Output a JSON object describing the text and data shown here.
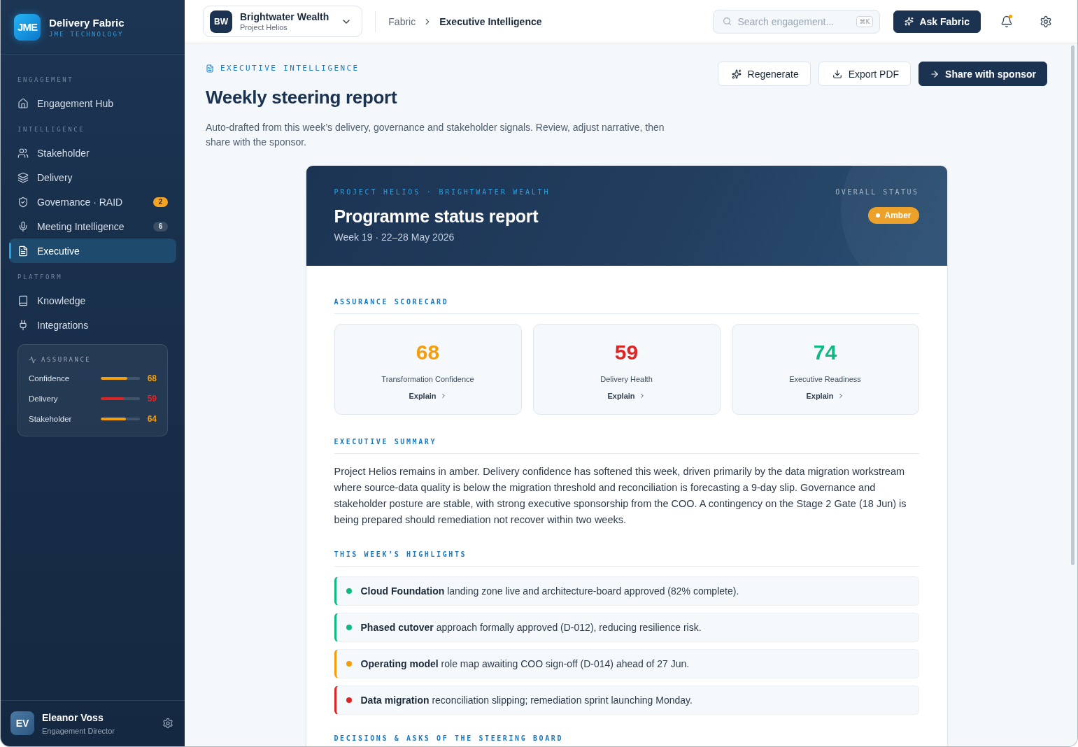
{
  "sidebar": {
    "brand": {
      "logo": "JME",
      "name": "Delivery Fabric",
      "tagline": "JME TECHNOLOGY"
    },
    "sections": [
      {
        "label": "ENGAGEMENT",
        "items": [
          {
            "label": "Engagement Hub",
            "selected": false
          }
        ]
      },
      {
        "label": "INTELLIGENCE",
        "items": [
          {
            "label": "Stakeholder",
            "selected": false
          },
          {
            "label": "Delivery",
            "selected": false
          },
          {
            "label": "Governance · RAID",
            "selected": false,
            "badge": {
              "text": "2",
              "kind": "alert"
            }
          },
          {
            "label": "Meeting Intelligence",
            "selected": false,
            "badge": {
              "text": "6",
              "kind": "count"
            }
          },
          {
            "label": "Executive",
            "selected": true
          }
        ]
      },
      {
        "label": "PLATFORM",
        "items": [
          {
            "label": "Knowledge",
            "selected": false
          },
          {
            "label": "Integrations",
            "selected": false
          }
        ]
      }
    ],
    "assurance": {
      "title": "ASSURANCE",
      "metrics": [
        {
          "label": "Confidence",
          "level": 0.68,
          "value": "68",
          "color": "#f59e0b"
        },
        {
          "label": "Delivery",
          "level": 0.59,
          "value": "59",
          "color": "#dc2626"
        },
        {
          "label": "Stakeholder",
          "level": 0.64,
          "value": "64",
          "color": "#f59e0b"
        }
      ]
    },
    "user": {
      "initials": "EV",
      "name": "Eleanor Voss",
      "role": "Engagement Director"
    }
  },
  "top_bar": {
    "engagement": {
      "initials": "BW",
      "name": "Brightwater Wealth",
      "project": "Project Helios"
    },
    "breadcrumb": [
      "Fabric",
      "Executive Intelligence"
    ],
    "search": {
      "placeholder": "Search engagement...",
      "shortcut": "⌘K"
    },
    "ask_button": "Ask Fabric",
    "notifications_unread": true
  },
  "page": {
    "eyebrow": "EXECUTIVE INTELLIGENCE",
    "title": "Weekly steering report",
    "description": "Auto-drafted from this week’s delivery, governance and stakeholder signals. Review, adjust narrative, then share with the sponsor.",
    "actions": [
      {
        "label": "Regenerate",
        "kind": "secondary"
      },
      {
        "label": "Export PDF",
        "kind": "secondary"
      },
      {
        "label": "Share with sponsor",
        "kind": "primary"
      }
    ]
  },
  "report": {
    "eyebrow": "PROJECT HELIOS · BRIGHTWATER WEALTH",
    "title": "Programme status report",
    "period": "Week 19 · 22–28 May 2026",
    "status_label": "OVERALL STATUS",
    "status": {
      "text": "Amber",
      "kind": "amber"
    },
    "scorecard_heading": "ASSURANCE SCORECARD",
    "scorecard": [
      {
        "value": "68",
        "label": "Transformation Confidence",
        "link": "Explain",
        "color": "#f59e0b"
      },
      {
        "value": "59",
        "label": "Delivery Health",
        "link": "Explain",
        "color": "#dc2626"
      },
      {
        "value": "74",
        "label": "Executive Readiness",
        "link": "Explain",
        "color": "#10b981"
      }
    ],
    "summary": {
      "heading": "EXECUTIVE SUMMARY",
      "text": "Project Helios remains in amber. Delivery confidence has softened this week, driven primarily by the data migration workstream where source-data quality is below the migration threshold and reconciliation is forecasting a 9-day slip. Governance and stakeholder posture are stable, with strong executive sponsorship from the COO. A contingency on the Stage 2 Gate (18 Jun) is being prepared should remediation not recover within two weeks."
    },
    "highlights": {
      "heading": "THIS WEEK’S HIGHLIGHTS",
      "items": [
        {
          "text": "**Cloud Foundation** landing zone live and architecture-board approved (82% complete).",
          "color": "#10b981"
        },
        {
          "text": "**Phased cutover** approach formally approved (D-012), reducing resilience risk.",
          "color": "#10b981"
        },
        {
          "text": "**Operating model** role map awaiting COO sign-off (D-014) ahead of 27 Jun.",
          "color": "#f59e0b"
        },
        {
          "text": "**Data migration** reconciliation slipping; remediation sprint launching Monday.",
          "color": "#dc2626"
        }
      ]
    },
    "next_heading": "DECISIONS & ASKS OF THE STEERING BOARD"
  }
}
